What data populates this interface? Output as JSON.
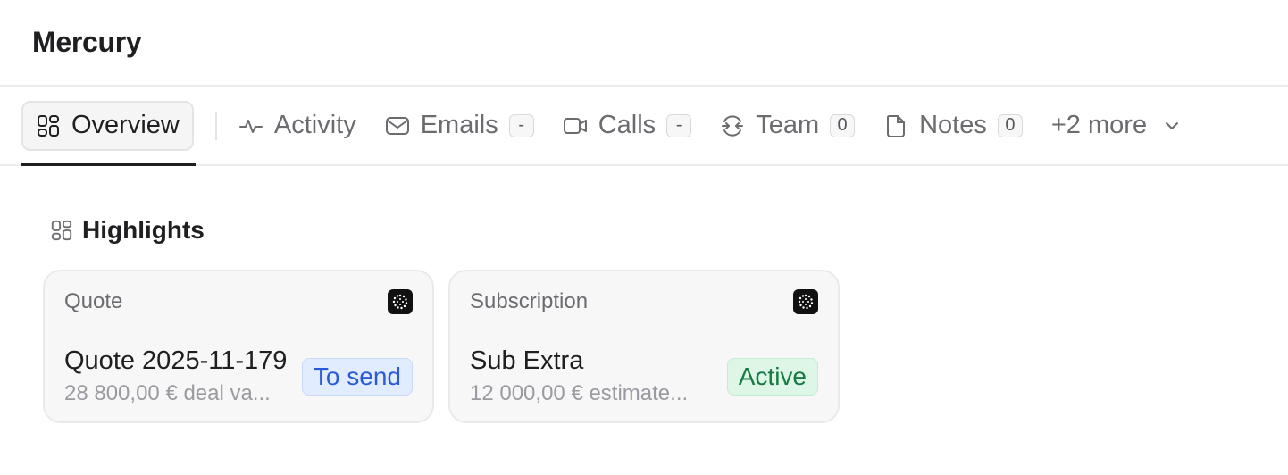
{
  "header": {
    "title": "Mercury"
  },
  "tabs": [
    {
      "label": "Overview",
      "icon": "grid-icon",
      "active": true
    },
    {
      "label": "Activity",
      "icon": "pulse-icon"
    },
    {
      "label": "Emails",
      "icon": "mail-icon",
      "badge": "-"
    },
    {
      "label": "Calls",
      "icon": "video-icon",
      "badge": "-"
    },
    {
      "label": "Team",
      "icon": "merge-arrows-icon",
      "badge": "0"
    },
    {
      "label": "Notes",
      "icon": "document-icon",
      "badge": "0"
    },
    {
      "label": "+2 more",
      "icon": "chevron-down-icon"
    }
  ],
  "highlights": {
    "title": "Highlights",
    "cards": [
      {
        "label": "Quote",
        "name": "Quote 2025-11-179",
        "sub": "28 800,00 € deal va...",
        "status": "To send",
        "status_color": "#2a5bd7"
      },
      {
        "label": "Subscription",
        "name": "Sub Extra",
        "sub": "12 000,00 € estimate...",
        "status": "Active",
        "status_color": "#177a45"
      }
    ]
  }
}
